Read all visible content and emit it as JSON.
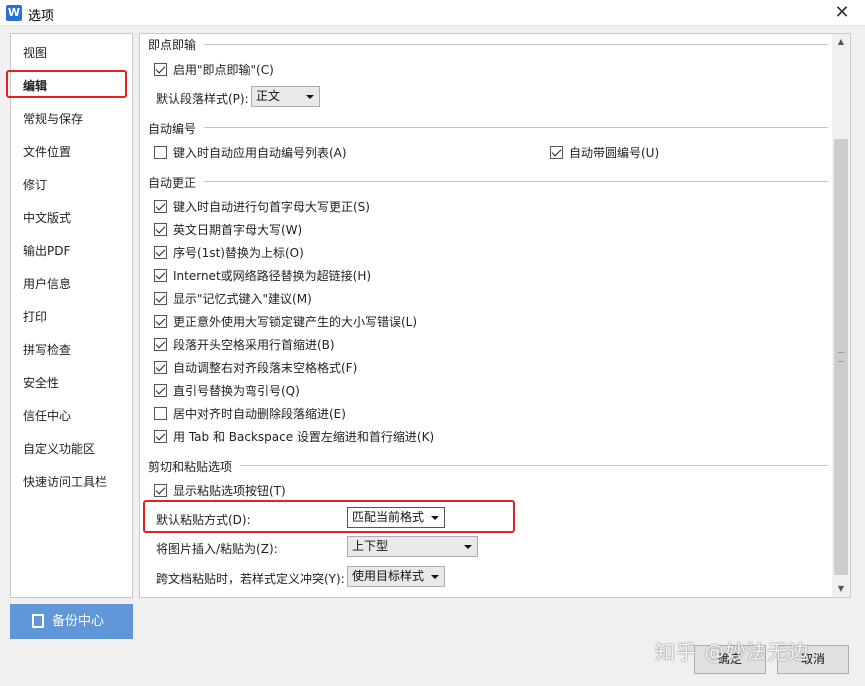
{
  "window": {
    "title": "选项",
    "app_icon_letter": "W",
    "close_glyph": "✕"
  },
  "sidebar": {
    "items": [
      {
        "label": "视图"
      },
      {
        "label": "编辑"
      },
      {
        "label": "常规与保存"
      },
      {
        "label": "文件位置"
      },
      {
        "label": "修订"
      },
      {
        "label": "中文版式"
      },
      {
        "label": "输出PDF"
      },
      {
        "label": "用户信息"
      },
      {
        "label": "打印"
      },
      {
        "label": "拼写检查"
      },
      {
        "label": "安全性"
      },
      {
        "label": "信任中心"
      },
      {
        "label": "自定义功能区"
      },
      {
        "label": "快速访问工具栏"
      }
    ],
    "selected": "编辑",
    "backup_label": "备份中心"
  },
  "sections": {
    "instant_input": {
      "title": "即点即输",
      "enable_label": "启用\"即点即输\"(C)",
      "enable_checked": true,
      "default_style_label": "默认段落样式(P):",
      "default_style_value": "正文"
    },
    "auto_numbering": {
      "title": "自动编号",
      "apply_list_label": "键入时自动应用自动编号列表(A)",
      "apply_list_checked": false,
      "circle_label": "自动带圆编号(U)",
      "circle_checked": true
    },
    "autocorrect": {
      "title": "自动更正",
      "options": [
        {
          "label": "键入时自动进行句首字母大写更正(S)",
          "checked": true
        },
        {
          "label": "英文日期首字母大写(W)",
          "checked": true
        },
        {
          "label": "序号(1st)替换为上标(O)",
          "checked": true
        },
        {
          "label": "Internet或网络路径替换为超链接(H)",
          "checked": true
        },
        {
          "label": "显示\"记忆式键入\"建议(M)",
          "checked": true
        },
        {
          "label": "更正意外使用大写锁定键产生的大小写错误(L)",
          "checked": true
        },
        {
          "label": "段落开头空格采用行首缩进(B)",
          "checked": true
        },
        {
          "label": "自动调整右对齐段落末空格格式(F)",
          "checked": true
        },
        {
          "label": "直引号替换为弯引号(Q)",
          "checked": true
        },
        {
          "label": "居中对齐时自动删除段落缩进(E)",
          "checked": false
        },
        {
          "label": "用 Tab 和 Backspace 设置左缩进和首行缩进(K)",
          "checked": true
        }
      ]
    },
    "cut_paste": {
      "title": "剪切和粘贴选项",
      "show_button_label": "显示粘贴选项按钮(T)",
      "show_button_checked": true,
      "default_paste_label": "默认粘贴方式(D):",
      "default_paste_value": "匹配当前格式",
      "image_insert_label": "将图片插入/粘贴为(Z):",
      "image_insert_value": "上下型",
      "cross_doc_label": "跨文档粘贴时，若样式定义冲突(Y):",
      "cross_doc_value": "使用目标样式"
    }
  },
  "footer": {
    "ok_label": "确定",
    "cancel_label": "取消"
  },
  "watermark": "知乎 @妙法无边",
  "colors": {
    "highlight": "#e02222",
    "accent": "#5f97d8"
  }
}
